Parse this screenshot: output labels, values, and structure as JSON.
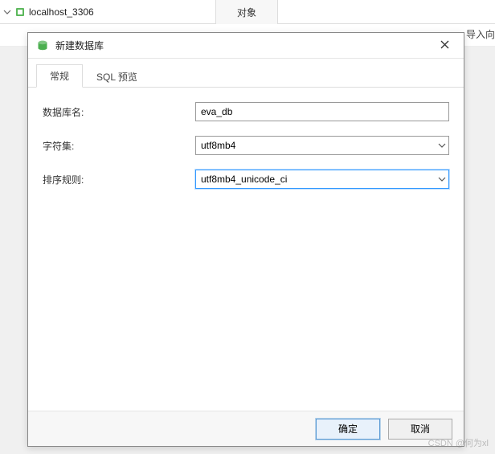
{
  "background": {
    "connection_name": "localhost_3306",
    "tab_label": "对象",
    "truncated_right": "导入向"
  },
  "dialog": {
    "title": "新建数据库",
    "tabs": {
      "general": "常规",
      "sql_preview": "SQL 预览"
    },
    "fields": {
      "db_name_label": "数据库名:",
      "db_name_value": "eva_db",
      "charset_label": "字符集:",
      "charset_value": "utf8mb4",
      "collation_label": "排序规则:",
      "collation_value": "utf8mb4_unicode_ci"
    },
    "buttons": {
      "ok": "确定",
      "cancel": "取消"
    }
  },
  "watermark": "CSDN @何为xl"
}
